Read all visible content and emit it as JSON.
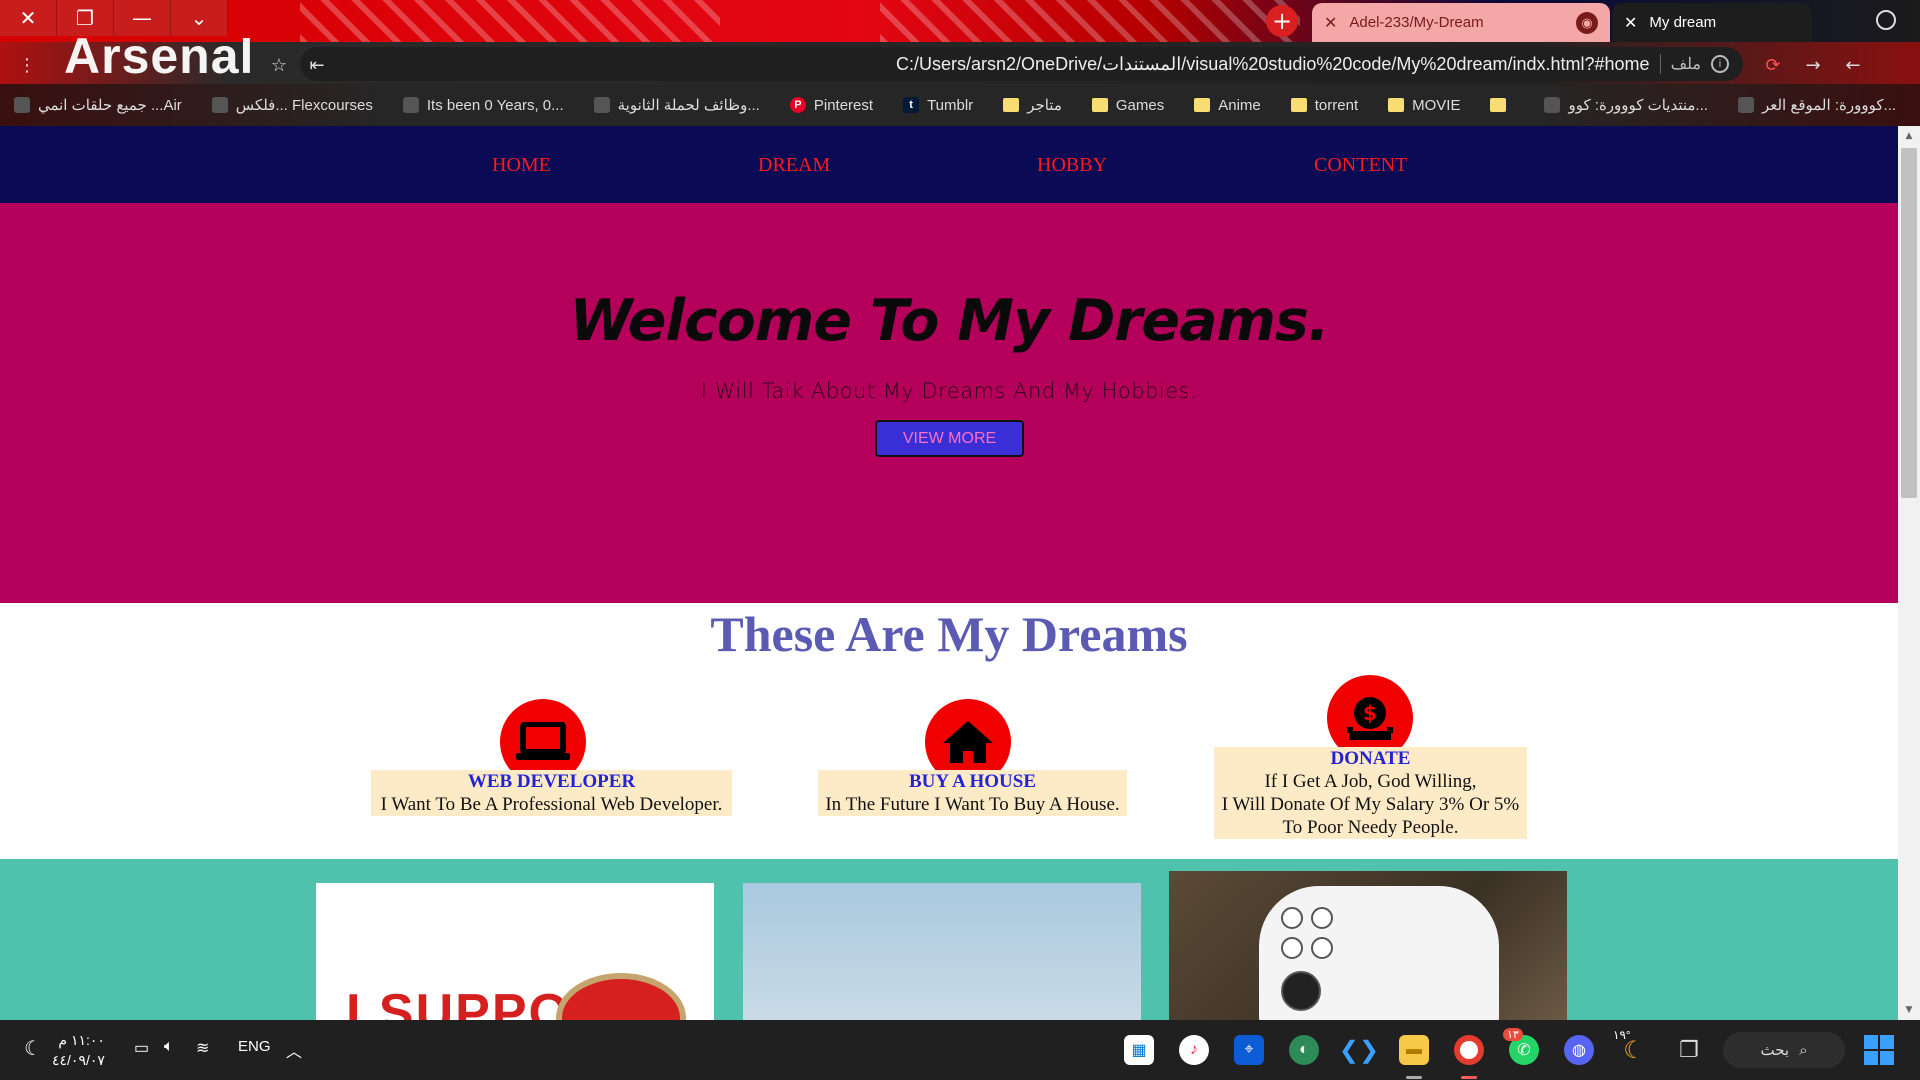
{
  "browser": {
    "tabs": [
      {
        "label": "Adel-233/My-Dream"
      },
      {
        "label": "My dream"
      }
    ],
    "address": "C:/Users/arsn2/OneDrive/المستندات/visual%20studio%20code/My%20dream/indx.html?#home",
    "address_label": "ملف",
    "theme_word": "Arsenal",
    "bookmarks": [
      {
        "label": "كووورة: الموقع العر...",
        "kind": "site"
      },
      {
        "label": "منتديات كووورة: كوو...",
        "kind": "site"
      },
      {
        "label": "",
        "kind": "folder"
      },
      {
        "label": "MOVIE",
        "kind": "folder"
      },
      {
        "label": "torrent",
        "kind": "folder"
      },
      {
        "label": "Anime",
        "kind": "folder"
      },
      {
        "label": "Games",
        "kind": "folder"
      },
      {
        "label": "متاجر",
        "kind": "folder"
      },
      {
        "label": "Tumblr",
        "kind": "tumblr"
      },
      {
        "label": "Pinterest",
        "kind": "pinterest"
      },
      {
        "label": "وظائف لحملة الثانوية...",
        "kind": "site"
      },
      {
        "label": "Its been 0 Years, 0...",
        "kind": "site"
      },
      {
        "label": "فلكس... Flexcourses",
        "kind": "site"
      },
      {
        "label": "جميع حلقات انمي ...Air",
        "kind": "site"
      }
    ]
  },
  "nav": {
    "home": "HOME",
    "dream": "DREAM",
    "hobby": "HOBBY",
    "content": "CONTENT"
  },
  "hero": {
    "title": "Welcome To My Dreams.",
    "subtitle": "I Will Taik About My Dreams And My Hobbies.",
    "button": "VIEW MORE"
  },
  "dreams": {
    "heading": "These Are My Dreams",
    "items": [
      {
        "title": "WEB DEVELOPER",
        "lines": [
          "I Want To Be A Professional Web Developer."
        ],
        "icon": "laptop-icon"
      },
      {
        "title": "BUY A HOUSE",
        "lines": [
          "In The Future I Want To Buy A House."
        ],
        "icon": "house-icon"
      },
      {
        "title": "DONATE",
        "lines": [
          "If I Get A Job, God Willing,",
          "I Will Donate Of My Salary 3% Or 5%",
          "To Poor Needy People."
        ],
        "icon": "donate-icon"
      }
    ]
  },
  "hobbies": {
    "card1_text": "I SUPPORT"
  },
  "taskbar": {
    "search": "بحث",
    "weather": "١٩°",
    "lang": "ENG",
    "time": "١١:٠٠ م",
    "date": "٤٤/٠٩/٠٧",
    "whatsapp_badge": "١٣"
  },
  "colors": {
    "nav_bg": "#0a0a55",
    "nav_link": "#ff1a1a",
    "hero_bg": "#b5005b",
    "button_bg": "#3a2fd6",
    "heading": "#5b5bb3",
    "icon_circle": "#f00000",
    "dream_box": "#fdebc7",
    "hobby_bg": "#4fc2ae"
  }
}
